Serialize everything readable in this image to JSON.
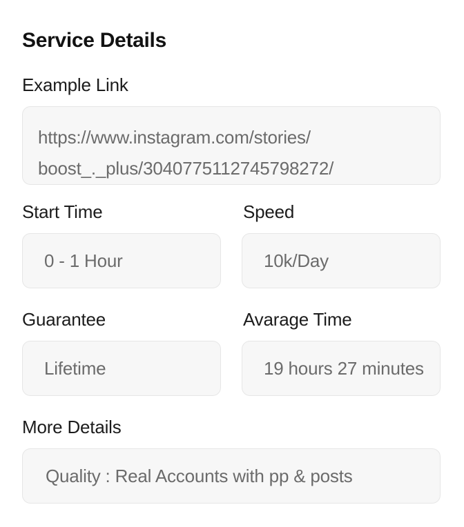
{
  "section": {
    "title": "Service Details"
  },
  "example_link": {
    "label": "Example Link",
    "value_line1": "https://www.instagram.com/stories/",
    "value_line2": "boost_._plus/3040775112745798272/"
  },
  "start_time": {
    "label": "Start Time",
    "value": "0 - 1 Hour"
  },
  "speed": {
    "label": "Speed",
    "value": "10k/Day"
  },
  "guarantee": {
    "label": "Guarantee",
    "value": "Lifetime"
  },
  "average_time": {
    "label": "Avarage Time",
    "value": "19 hours 27 minutes"
  },
  "more_details": {
    "label": "More Details",
    "value": "Quality : Real Accounts with pp & posts"
  }
}
